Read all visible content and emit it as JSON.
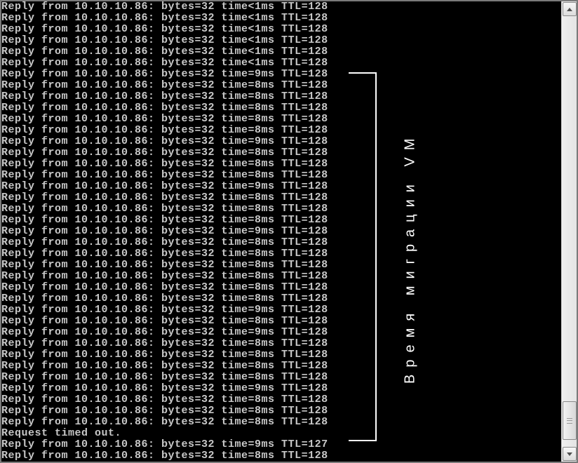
{
  "ping": {
    "ip": "10.10.10.86",
    "bytes": 32,
    "ttl": 128,
    "timeout_text": "Request timed out.",
    "reply_prefix": "Reply from",
    "bytes_label": "bytes",
    "time_label": "time",
    "ttl_label": "TTL",
    "lines": [
      {
        "time": "<1ms",
        "timeout": false
      },
      {
        "time": "<1ms",
        "timeout": false
      },
      {
        "time": "<1ms",
        "timeout": false
      },
      {
        "time": "<1ms",
        "timeout": false
      },
      {
        "time": "<1ms",
        "timeout": false
      },
      {
        "time": "<1ms",
        "timeout": false
      },
      {
        "time": "9ms",
        "timeout": false
      },
      {
        "time": "8ms",
        "timeout": false
      },
      {
        "time": "8ms",
        "timeout": false
      },
      {
        "time": "8ms",
        "timeout": false
      },
      {
        "time": "8ms",
        "timeout": false
      },
      {
        "time": "8ms",
        "timeout": false
      },
      {
        "time": "9ms",
        "timeout": false
      },
      {
        "time": "8ms",
        "timeout": false
      },
      {
        "time": "8ms",
        "timeout": false
      },
      {
        "time": "8ms",
        "timeout": false
      },
      {
        "time": "9ms",
        "timeout": false
      },
      {
        "time": "8ms",
        "timeout": false
      },
      {
        "time": "8ms",
        "timeout": false
      },
      {
        "time": "8ms",
        "timeout": false
      },
      {
        "time": "9ms",
        "timeout": false
      },
      {
        "time": "8ms",
        "timeout": false
      },
      {
        "time": "8ms",
        "timeout": false
      },
      {
        "time": "8ms",
        "timeout": false
      },
      {
        "time": "8ms",
        "timeout": false
      },
      {
        "time": "8ms",
        "timeout": false
      },
      {
        "time": "8ms",
        "timeout": false
      },
      {
        "time": "9ms",
        "timeout": false
      },
      {
        "time": "8ms",
        "timeout": false
      },
      {
        "time": "9ms",
        "timeout": false
      },
      {
        "time": "8ms",
        "timeout": false
      },
      {
        "time": "8ms",
        "timeout": false
      },
      {
        "time": "8ms",
        "timeout": false
      },
      {
        "time": "8ms",
        "timeout": false
      },
      {
        "time": "9ms",
        "timeout": false
      },
      {
        "time": "8ms",
        "timeout": false
      },
      {
        "time": "8ms",
        "timeout": false
      },
      {
        "time": "8ms",
        "timeout": false
      },
      {
        "time": null,
        "timeout": true
      },
      {
        "time": "9ms",
        "timeout": false,
        "ttl_override": 127
      },
      {
        "time": "8ms",
        "timeout": false
      }
    ]
  },
  "annotation": {
    "label": "Время миграции VM"
  }
}
